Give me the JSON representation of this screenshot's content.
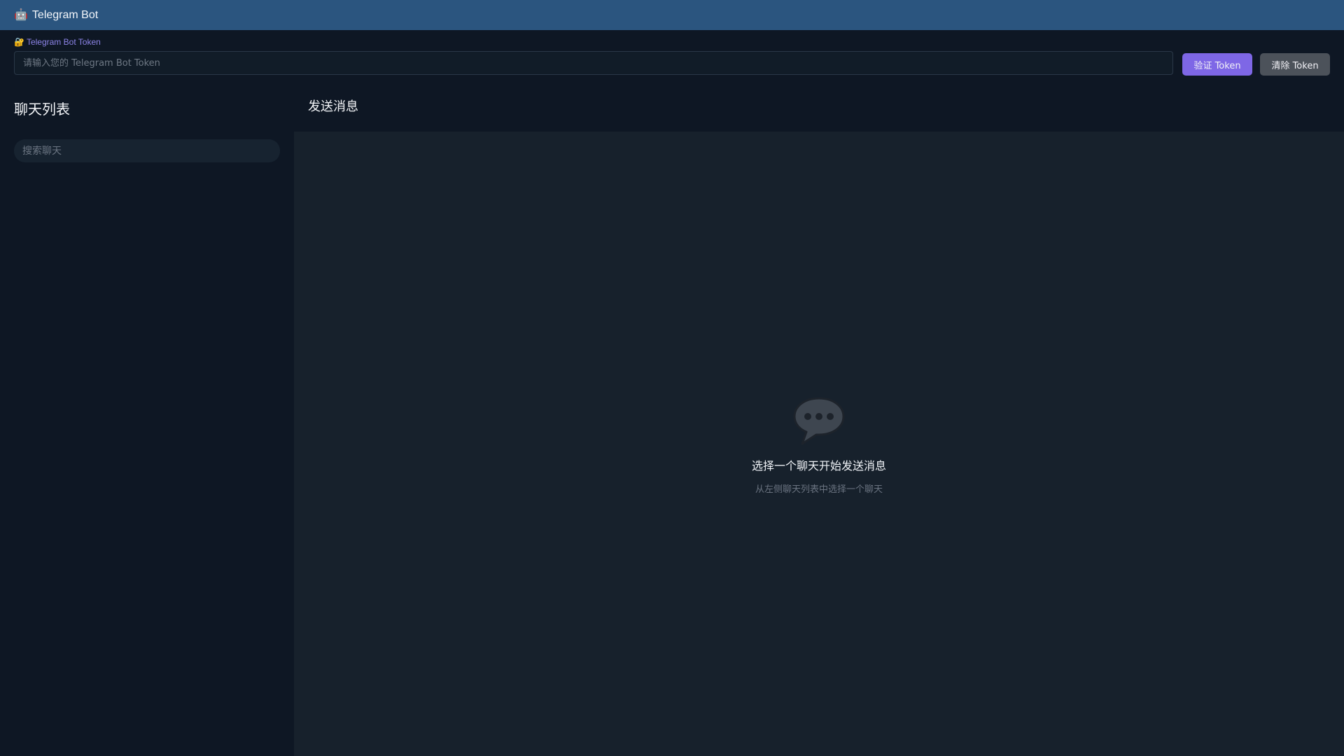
{
  "header": {
    "icon": "robot-icon",
    "icon_glyph": "🤖",
    "title": "Telegram Bot"
  },
  "token": {
    "label_icon": "lock-icon",
    "label_glyph": "🔐",
    "label": "Telegram Bot Token",
    "input_value": "",
    "placeholder": "请输入您的 Telegram Bot Token",
    "verify_label": "验证 Token",
    "clear_label": "清除 Token"
  },
  "sidebar": {
    "title": "聊天列表",
    "search_placeholder": "搜索聊天",
    "items": []
  },
  "main": {
    "title": "发送消息",
    "empty_icon": "chat-bubble-icon",
    "empty_title": "选择一个聊天开始发送消息",
    "empty_subtitle": "从左侧聊天列表中选择一个聊天"
  },
  "colors": {
    "topbar": "#2b557f",
    "page_bg": "#0e1724",
    "panel_bg": "#17212c",
    "accent": "#7e67e6",
    "secondary_button": "#4c525a",
    "label_accent": "#8d84e8"
  }
}
